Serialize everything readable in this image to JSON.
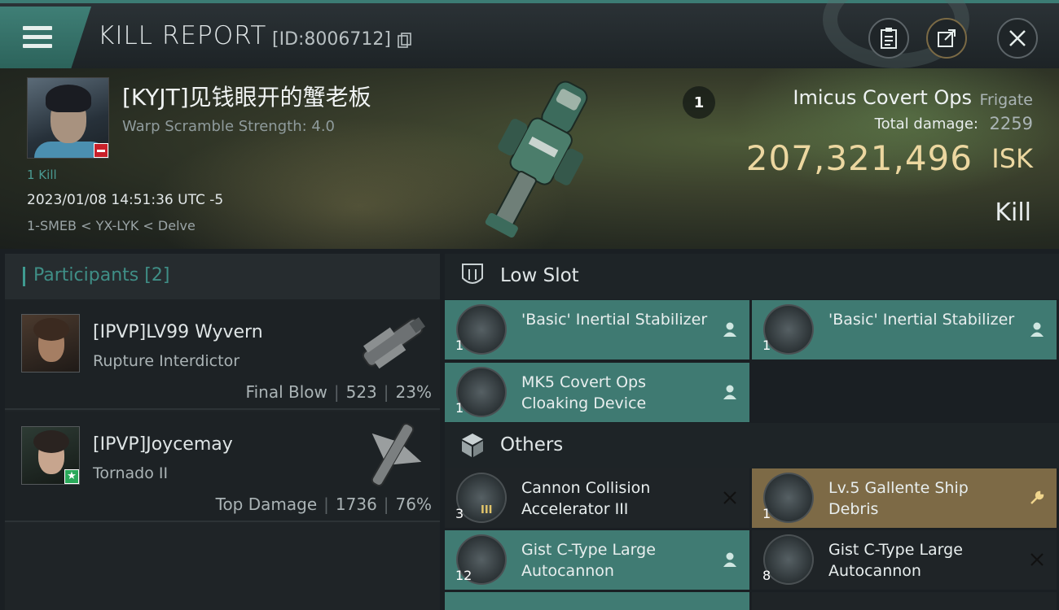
{
  "header": {
    "title": "KILL REPORT",
    "report_id": "[ID:8006712]",
    "icons": [
      "menu-icon",
      "copy-icon",
      "clipboard-icon",
      "share-icon",
      "close-icon"
    ]
  },
  "victim": {
    "name": "[KYJT]见钱眼开的蟹老板",
    "warp_scramble": "Warp Scramble Strength: 4.0",
    "kill_count": "1 Kill",
    "datetime": "2023/01/08 14:51:36 UTC -5",
    "location": "1-SMEB < YX-LYK < Delve",
    "attacker_count": "1",
    "ship_name": "Imicus Covert Ops",
    "ship_class": "Frigate",
    "total_damage_label": "Total damage:",
    "total_damage_value": "2259",
    "isk_value": "207,321,496",
    "isk_unit": "ISK",
    "kill_type": "Kill"
  },
  "participants": {
    "title": "Participants",
    "count": "[2]",
    "rows": [
      {
        "name": "[IPVP]LV99 Wyvern",
        "ship": "Rupture Interdictor",
        "tag": "Final Blow",
        "damage": "523",
        "percent": "23%"
      },
      {
        "name": "[IPVP]Joycemay",
        "ship": "Tornado II",
        "tag": "Top Damage",
        "damage": "1736",
        "percent": "76%"
      }
    ]
  },
  "low_slot": {
    "title": "Low Slot",
    "modules": [
      {
        "name": "'Basic' Inertial Stabilizer",
        "qty": "1"
      },
      {
        "name": "'Basic' Inertial Stabilizer",
        "qty": "1"
      },
      {
        "name": "MK5 Covert Ops Cloaking Device",
        "qty": "1"
      }
    ]
  },
  "others": {
    "title": "Others",
    "modules": [
      {
        "name": "Cannon Collision Accelerator III",
        "qty": "3",
        "tier": "III"
      },
      {
        "name": "Lv.5 Gallente Ship Debris",
        "qty": "1"
      },
      {
        "name": "Gist C-Type Large Autocannon",
        "qty": "12"
      },
      {
        "name": "Gist C-Type Large Autocannon",
        "qty": "8"
      }
    ]
  },
  "colors": {
    "accent_teal": "#3f7a72",
    "isk_gold": "#ecd7a0",
    "dropped_gold": "#7d6a46"
  }
}
